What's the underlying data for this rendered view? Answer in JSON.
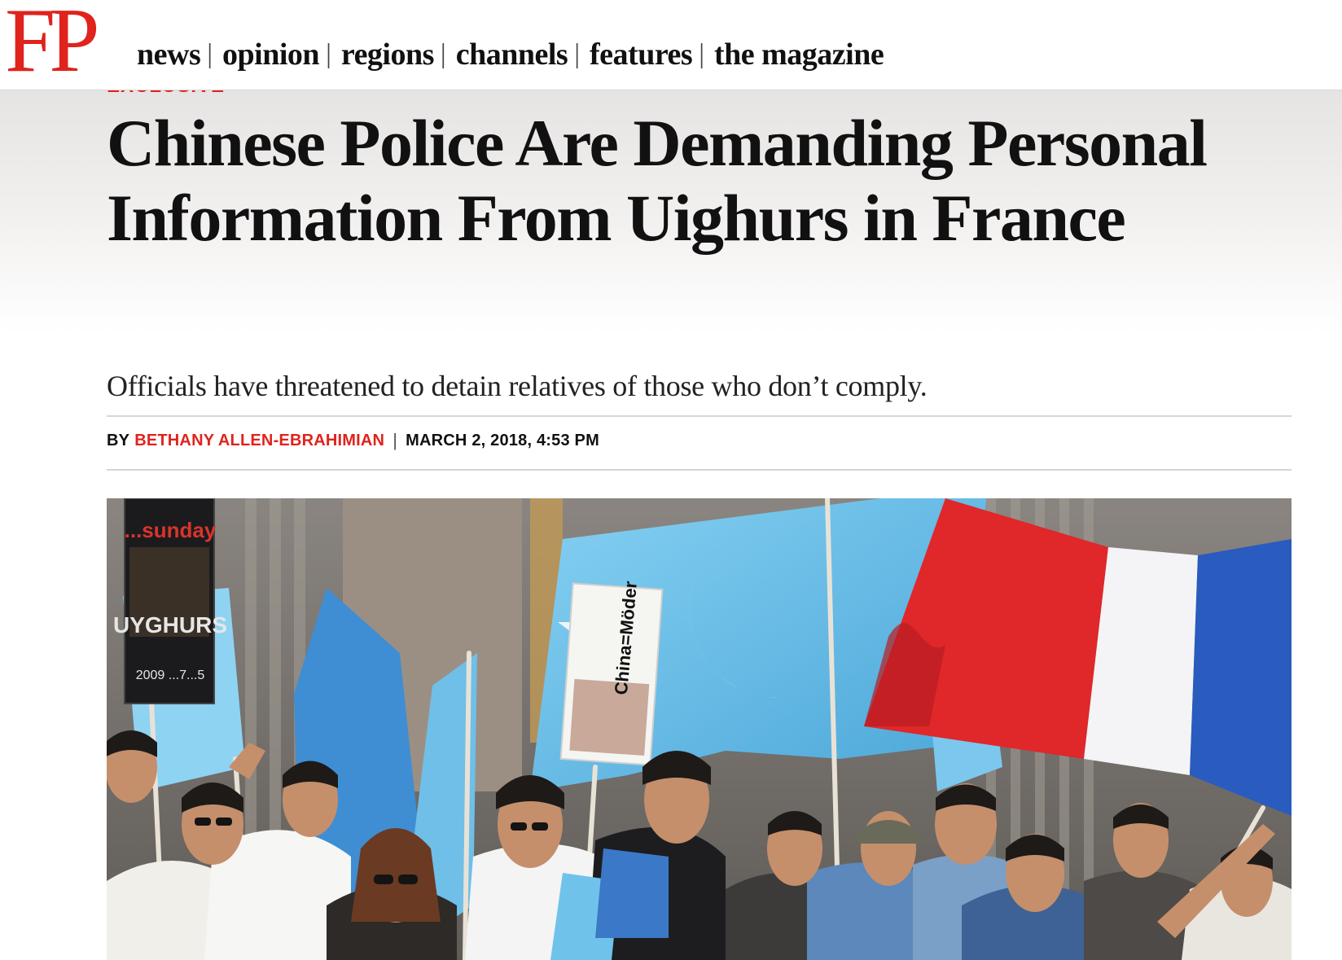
{
  "header": {
    "logo_text": "FP",
    "nav": [
      {
        "label": "news"
      },
      {
        "label": "opinion"
      },
      {
        "label": "regions"
      },
      {
        "label": "channels"
      },
      {
        "label": "features"
      },
      {
        "label": "the magazine"
      }
    ],
    "separator": "|"
  },
  "article": {
    "kicker": "EXCLUSIVE",
    "title": "Chinese Police Are Demanding Personal Information From Uighurs in France",
    "dek": "Officials have threatened to detain relatives of those who don’t comply.",
    "byline": {
      "prefix": "BY",
      "author": "BETHANY ALLEN-EBRAHIMIAN",
      "separator": "|",
      "date": "MARCH 2, 2018, 4:53 PM"
    },
    "photo": {
      "signs": {
        "left_top": "...sunday",
        "left_main": "UYGHURS",
        "left_bottom": "2009 ...7...5",
        "center": "China=Möder"
      }
    }
  },
  "colors": {
    "brand_red": "#e0231d",
    "text": "#111111",
    "rule": "#d6d6d6",
    "east_turkestan_blue": "#6fc3ea",
    "french_blue": "#2a5bbf",
    "french_red": "#e0272a"
  }
}
